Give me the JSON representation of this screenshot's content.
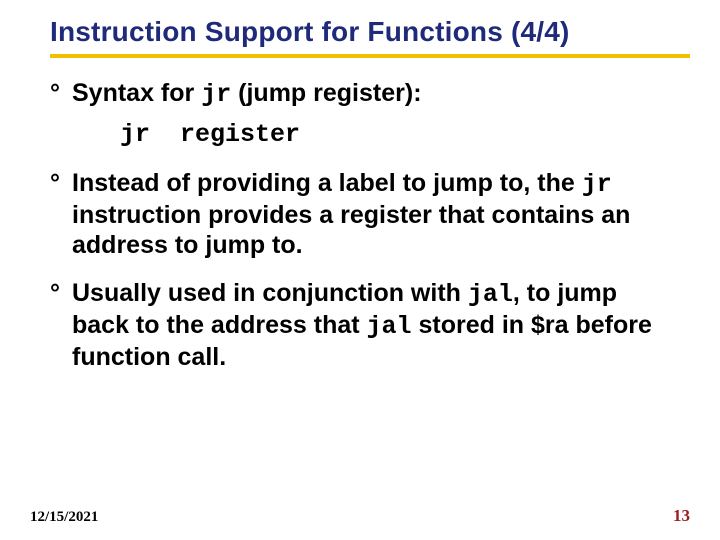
{
  "title": "Instruction Support for Functions (4/4)",
  "bullets": {
    "b1": {
      "pre": "Syntax for ",
      "code": "jr",
      "post": " (jump register):"
    },
    "b1_sub": {
      "code1": "jr",
      "gap": "  ",
      "code2": "register"
    },
    "b2": {
      "pre": "Instead of providing a label to jump to, the ",
      "code": "jr",
      "post": " instruction provides a register that contains an address to jump to."
    },
    "b3": {
      "pre": "Usually used in conjunction with ",
      "code1": "jal",
      "mid": ", to jump back to the address that ",
      "code2": "jal",
      "post": " stored in $ra before function call."
    }
  },
  "footer": {
    "date": "12/15/2021",
    "page": "13"
  }
}
